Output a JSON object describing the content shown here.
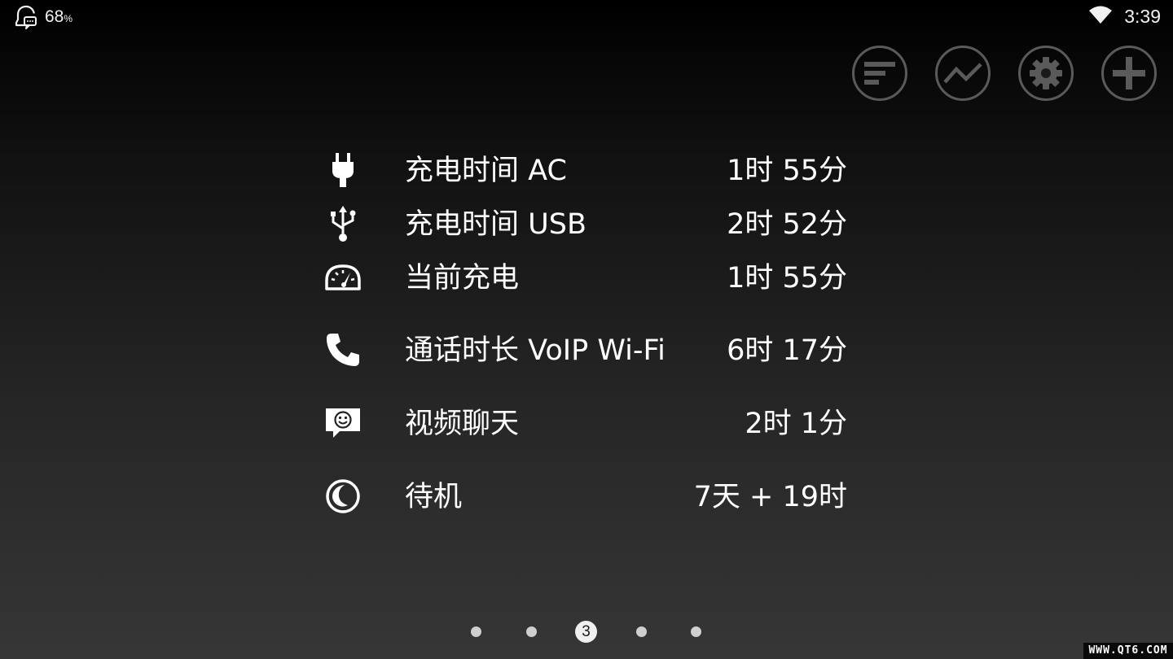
{
  "status_bar": {
    "battery_value": "68",
    "battery_unit": "%",
    "time": "3:39"
  },
  "toolbar": {
    "buttons": [
      {
        "icon": "bar-list-icon"
      },
      {
        "icon": "line-chart-icon"
      },
      {
        "icon": "gear-icon"
      },
      {
        "icon": "plus-icon"
      }
    ]
  },
  "stats": [
    {
      "icon": "plug-icon",
      "label": "充电时间 AC",
      "value": "1时 55分"
    },
    {
      "icon": "usb-icon",
      "label": "充电时间 USB",
      "value": "2时 52分"
    },
    {
      "icon": "speedometer-icon",
      "label": "当前充电",
      "value": "1时 55分"
    },
    {
      "icon": "phone-icon",
      "label": "通话时长 VoIP Wi-Fi",
      "value": "6时 17分"
    },
    {
      "icon": "video-chat-icon",
      "label": "视频聊天",
      "value": "2时 1分"
    },
    {
      "icon": "moon-icon",
      "label": "待机",
      "value": "7天 + 19时"
    }
  ],
  "pager": {
    "current_page": "3",
    "total_pages": 5
  },
  "watermark": "WWW.QT6.COM",
  "colors": {
    "background_top": "#000000",
    "background_bottom": "#363636",
    "button_ring": "#5a5a5a",
    "text": "#ffffff"
  }
}
